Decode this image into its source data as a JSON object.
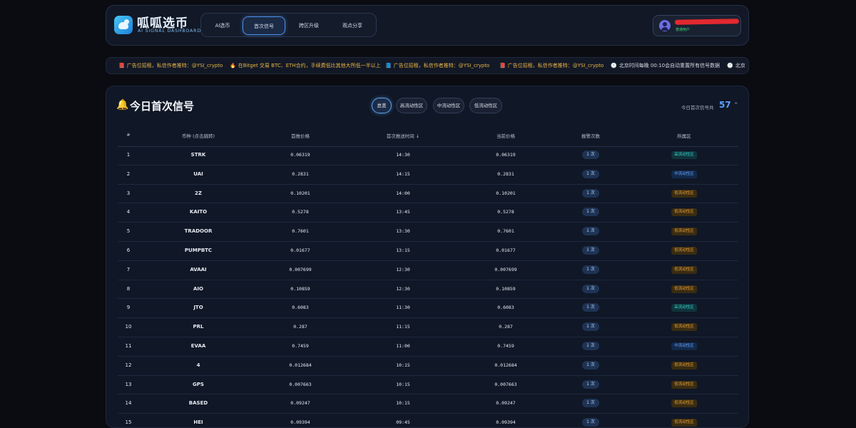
{
  "header": {
    "app_name": "呱呱选币",
    "app_subtitle": "AI SIGNAL DASHBOARD",
    "nav_tabs": [
      "AI选币",
      "首次信号",
      "跨区升级",
      "观点分享"
    ],
    "active_tab": "首次信号",
    "user": {
      "status": "普通用户"
    }
  },
  "ticker": {
    "items": [
      {
        "icon": "📕",
        "text": "广告位招租，私信作者推特：@YSI_crypto",
        "color": "#e8b546"
      },
      {
        "icon": "🔥",
        "text": "在Bitget 交易 BTC、ETH合约，手续费低比其他大所低一半以上",
        "color": "#e8b546"
      },
      {
        "icon": "📘",
        "text": "广告位招租，私信作者推特：@YSI_crypto",
        "color": "#e8b546"
      },
      {
        "icon": "📕",
        "text": "广告位招租，私信作者推特：@YSI_crypto",
        "color": "#e8b546"
      },
      {
        "icon": "🕛",
        "text": "北京时间每晚 00:10会自动重置所有信号数据",
        "color": "#d3d7e0"
      },
      {
        "icon": "🕛",
        "text": "北京",
        "color": "#d3d7e0"
      }
    ]
  },
  "panel": {
    "title": "今日首次信号",
    "filters": [
      "总览",
      "高流动性区",
      "中流动性区",
      "低流动性区"
    ],
    "active_filter": "总览",
    "count_label": "今日首次信号共",
    "count_value": "57",
    "columns": [
      "#",
      "币种 (点击跳转)",
      "首推价格",
      "首次推送时间 ↓",
      "当前价格",
      "报警次数",
      "所属区"
    ],
    "rows": [
      {
        "idx": "1",
        "coin": "STRK",
        "first_price": "0.06319",
        "time": "14:30",
        "current_price": "0.06319",
        "alerts": "1 次",
        "zone": "高流动性区",
        "zone_type": "high"
      },
      {
        "idx": "2",
        "coin": "UAI",
        "first_price": "0.2831",
        "time": "14:15",
        "current_price": "0.2831",
        "alerts": "1 次",
        "zone": "中流动性区",
        "zone_type": "mid"
      },
      {
        "idx": "3",
        "coin": "2Z",
        "first_price": "0.10201",
        "time": "14:00",
        "current_price": "0.10201",
        "alerts": "1 次",
        "zone": "低流动性区",
        "zone_type": "low"
      },
      {
        "idx": "4",
        "coin": "KAITO",
        "first_price": "0.5278",
        "time": "13:45",
        "current_price": "0.5278",
        "alerts": "1 次",
        "zone": "低流动性区",
        "zone_type": "low"
      },
      {
        "idx": "5",
        "coin": "TRADOOR",
        "first_price": "0.7601",
        "time": "13:30",
        "current_price": "0.7601",
        "alerts": "1 次",
        "zone": "低流动性区",
        "zone_type": "low"
      },
      {
        "idx": "6",
        "coin": "PUMPBTC",
        "first_price": "0.01677",
        "time": "13:15",
        "current_price": "0.01677",
        "alerts": "1 次",
        "zone": "低流动性区",
        "zone_type": "low"
      },
      {
        "idx": "7",
        "coin": "AVAAI",
        "first_price": "0.007699",
        "time": "12:30",
        "current_price": "0.007699",
        "alerts": "1 次",
        "zone": "低流动性区",
        "zone_type": "low"
      },
      {
        "idx": "8",
        "coin": "AIO",
        "first_price": "0.10859",
        "time": "12:30",
        "current_price": "0.10859",
        "alerts": "1 次",
        "zone": "低流动性区",
        "zone_type": "low"
      },
      {
        "idx": "9",
        "coin": "JTO",
        "first_price": "0.6083",
        "time": "11:30",
        "current_price": "0.6083",
        "alerts": "1 次",
        "zone": "高流动性区",
        "zone_type": "high"
      },
      {
        "idx": "10",
        "coin": "PRL",
        "first_price": "0.287",
        "time": "11:15",
        "current_price": "0.287",
        "alerts": "1 次",
        "zone": "低流动性区",
        "zone_type": "low"
      },
      {
        "idx": "11",
        "coin": "EVAA",
        "first_price": "0.7459",
        "time": "11:00",
        "current_price": "0.7459",
        "alerts": "1 次",
        "zone": "中流动性区",
        "zone_type": "mid"
      },
      {
        "idx": "12",
        "coin": "4",
        "first_price": "0.012684",
        "time": "10:15",
        "current_price": "0.012684",
        "alerts": "1 次",
        "zone": "低流动性区",
        "zone_type": "low"
      },
      {
        "idx": "13",
        "coin": "GPS",
        "first_price": "0.007663",
        "time": "10:15",
        "current_price": "0.007663",
        "alerts": "1 次",
        "zone": "低流动性区",
        "zone_type": "low"
      },
      {
        "idx": "14",
        "coin": "BASED",
        "first_price": "0.09247",
        "time": "10:15",
        "current_price": "0.09247",
        "alerts": "1 次",
        "zone": "低流动性区",
        "zone_type": "low"
      },
      {
        "idx": "15",
        "coin": "HEI",
        "first_price": "0.09394",
        "time": "09:45",
        "current_price": "0.09394",
        "alerts": "1 次",
        "zone": "低流动性区",
        "zone_type": "low"
      }
    ]
  }
}
